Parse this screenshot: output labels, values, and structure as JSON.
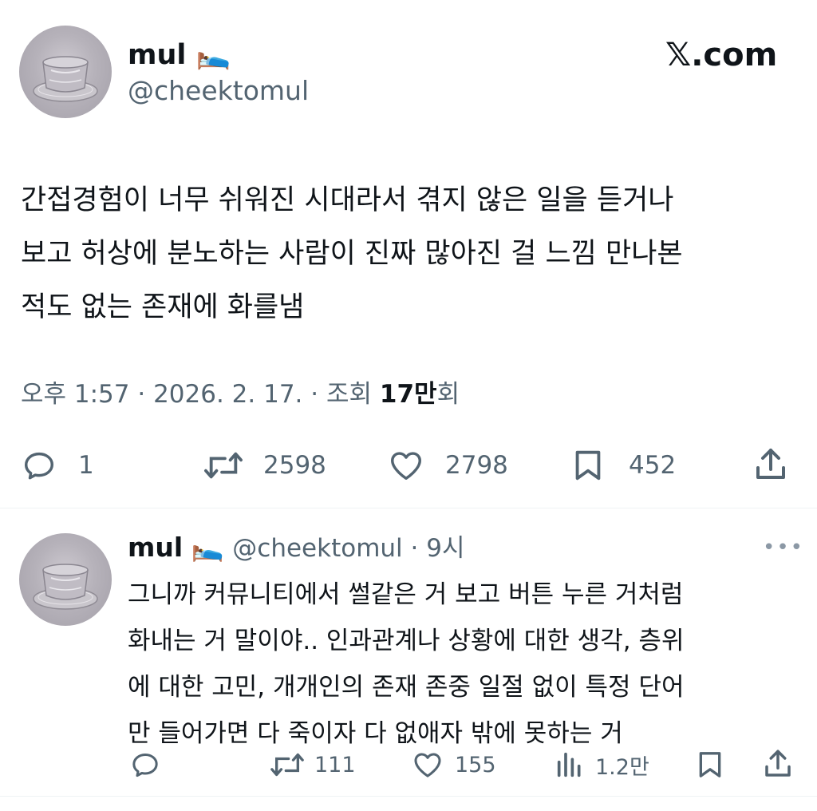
{
  "brand": {
    "logo_text": "𝕏.com"
  },
  "main_tweet": {
    "author": {
      "name": "mul",
      "name_emoji": "🛌",
      "handle": "@cheektomul"
    },
    "text_lines": [
      "간접경험이 너무 쉬워진 시대라서 겪지 않은 일을 듣거나",
      "보고 허상에 분노하는 사람이 진짜 많아진 걸 느낌 만나본",
      "적도 없는 존재에 화를냄"
    ],
    "meta": {
      "time": "오후 1:57",
      "sep1": " · ",
      "date": "2026. 2. 17.",
      "sep2": " · ",
      "views_label": "조회 ",
      "views_count": "17만",
      "views_suffix": "회"
    },
    "actions": {
      "reply_icon": "reply-icon",
      "reply_count": "1",
      "retweet_icon": "retweet-icon",
      "retweet_count": "2598",
      "like_icon": "heart-icon",
      "like_count": "2798",
      "bookmark_icon": "bookmark-icon",
      "bookmark_count": "452",
      "share_icon": "share-icon"
    }
  },
  "reply_tweet": {
    "author": {
      "name": "mul",
      "name_emoji": "🛌",
      "handle": "@cheektomul",
      "time": " · 9시"
    },
    "more_label": "•••",
    "text_lines": [
      "그니까 커뮤니티에서 썰같은 거 보고 버튼 누른 거처럼",
      "화내는 거 말이야.. 인과관계나 상황에 대한 생각, 층위",
      "에 대한 고민, 개개인의 존재 존중 일절 없이 특정 단어",
      "만 들어가면 다 죽이자 다 없애자 밖에 못하는 거"
    ],
    "actions": {
      "reply_icon": "reply-icon",
      "retweet_icon": "retweet-icon",
      "retweet_count": "111",
      "like_icon": "heart-icon",
      "like_count": "155",
      "views_icon": "bar-chart-icon",
      "views_count": "1.2만",
      "bookmark_icon": "bookmark-icon",
      "share_icon": "share-icon"
    }
  },
  "colors": {
    "text": "#0f1419",
    "secondary": "#536471",
    "divider": "#eff3f4",
    "background": "#ffffff"
  }
}
